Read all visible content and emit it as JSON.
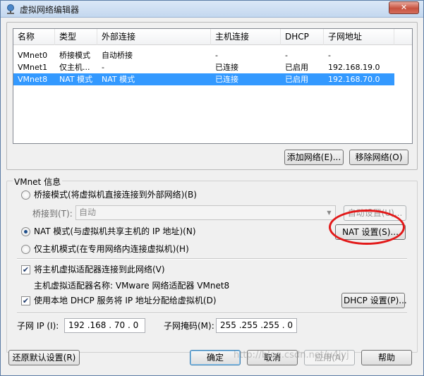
{
  "window": {
    "title": "虚拟网络编辑器",
    "close_label": "✕"
  },
  "network_list": {
    "columns": [
      "名称",
      "类型",
      "外部连接",
      "主机连接",
      "DHCP",
      "子网地址"
    ],
    "rows": [
      [
        "VMnet0",
        "桥接模式",
        "自动桥接",
        "-",
        "-",
        "-"
      ],
      [
        "VMnet1",
        "仅主机...",
        "-",
        "已连接",
        "已启用",
        "192.168.19.0"
      ],
      [
        "VMnet8",
        "NAT 模式",
        "NAT 模式",
        "已连接",
        "已启用",
        "192.168.70.0"
      ]
    ],
    "selected_index": 2
  },
  "buttons": {
    "add_network": "添加网络(E)...",
    "remove_network": "移除网络(O)",
    "auto_settings": "自动设置(U)...",
    "nat_settings": "NAT 设置(S)...",
    "dhcp_settings": "DHCP 设置(P)...",
    "restore_defaults": "还原默认设置(R)",
    "ok": "确定",
    "cancel": "取消",
    "apply": "应用(A)",
    "help": "帮助"
  },
  "vmnet_info": {
    "legend": "VMnet 信息",
    "bridge_mode": "桥接模式(将虚拟机直接连接到外部网络)(B)",
    "bridge_to_label": "桥接到(T):",
    "bridge_to_value": "自动",
    "nat_mode": "NAT 模式(与虚拟机共享主机的 IP 地址)(N)",
    "host_only_mode": "仅主机模式(在专用网络内连接虚拟机)(H)",
    "selected_mode": "nat",
    "connect_adapter": "将主机虚拟适配器连接到此网络(V)",
    "connect_adapter_checked": true,
    "adapter_name": "主机虚拟适配器名称: VMware 网络适配器 VMnet8",
    "use_dhcp": "使用本地 DHCP 服务将 IP 地址分配给虚拟机(D)",
    "use_dhcp_checked": true,
    "subnet_ip_label": "子网 IP (I):",
    "subnet_ip_value": "192 .168 . 70 . 0",
    "subnet_mask_label": "子网掩码(M):",
    "subnet_mask_value": "255 .255 .255 . 0"
  },
  "watermark": "http://blog.csdn.net/u4jyj",
  "colors": {
    "selection": "#3399ff",
    "highlight_ring": "#e21818"
  }
}
